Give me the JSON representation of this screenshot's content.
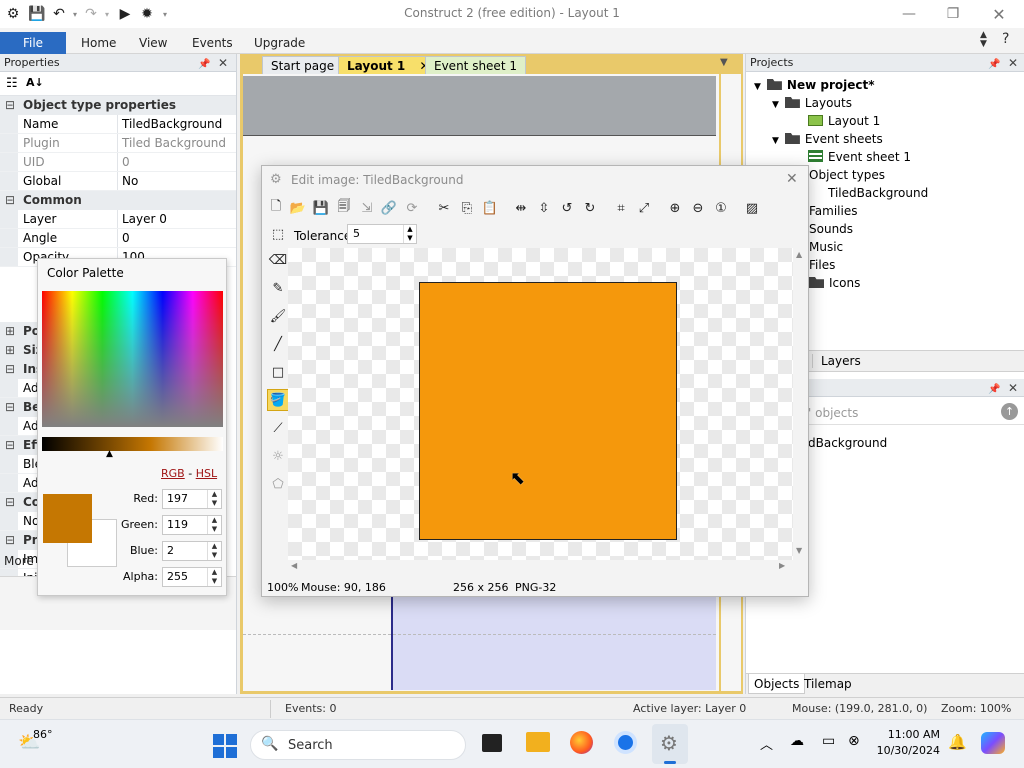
{
  "app": {
    "title": "Construct 2  (free edition) - Layout 1"
  },
  "ribbon": {
    "file": "File",
    "tabs": [
      "Home",
      "View",
      "Events",
      "Upgrade"
    ]
  },
  "doc_tabs": {
    "start": "Start page",
    "layout": "Layout 1",
    "events": "Event sheet 1"
  },
  "properties": {
    "title": "Properties",
    "section_object": "Object type properties",
    "name_key": "Name",
    "name_val": "TiledBackground",
    "plugin_key": "Plugin",
    "plugin_val": "Tiled Background",
    "uid_key": "UID",
    "uid_val": "0",
    "global_key": "Global",
    "global_val": "No",
    "section_common": "Common",
    "layer_key": "Layer",
    "layer_val": "Layer 0",
    "angle_key": "Angle",
    "angle_val": "0",
    "opacity_key": "Opacity",
    "opacity_val": "100",
    "partial_rows": [
      "Po",
      "Siz",
      "Ins",
      "Ad",
      "Be",
      "Ad",
      "Eff",
      "Ble",
      "Ad",
      "Co",
      "No",
      "Pr",
      "Im",
      "Init",
      "Ho"
    ],
    "more": "More i"
  },
  "projects": {
    "title": "Projects",
    "root": "New project*",
    "layouts": "Layouts",
    "layout1": "Layout 1",
    "event_sheets": "Event sheets",
    "event_sheet1": "Event sheet 1",
    "object_types": "Object types",
    "tiledbg": "TiledBackground",
    "families": "Families",
    "sounds": "Sounds",
    "music": "Music",
    "files": "Files",
    "icons": "Icons",
    "layers_tab": "Layers",
    "objects_header": "' objects",
    "object_item": "dBackground",
    "tab_objects": "Objects",
    "tab_tilemap": "Tilemap"
  },
  "edit_image": {
    "title": "Edit image: TiledBackground",
    "tolerance_label": "Tolerance",
    "tolerance_value": "5",
    "status_zoom": "100%",
    "status_mouse": "Mouse: 90, 186",
    "status_size": "256 x 256",
    "status_format": "PNG-32",
    "fill_color": "#f5980c"
  },
  "palette": {
    "title": "Color Palette",
    "rgb": "RGB",
    "sep": "-",
    "hsl": "HSL",
    "red_label": "Red:",
    "red": "197",
    "green_label": "Green:",
    "green": "119",
    "blue_label": "Blue:",
    "blue": "2",
    "alpha_label": "Alpha:",
    "alpha": "255",
    "current_color": "#c57702"
  },
  "statusbar": {
    "ready": "Ready",
    "events": "Events: 0",
    "active_layer": "Active layer: Layer 0",
    "mouse": "Mouse: (199.0, 281.0, 0)",
    "zoom": "Zoom: 100%"
  },
  "taskbar": {
    "temp": "86°",
    "search": "Search",
    "time": "11:00 AM",
    "date": "10/30/2024"
  }
}
